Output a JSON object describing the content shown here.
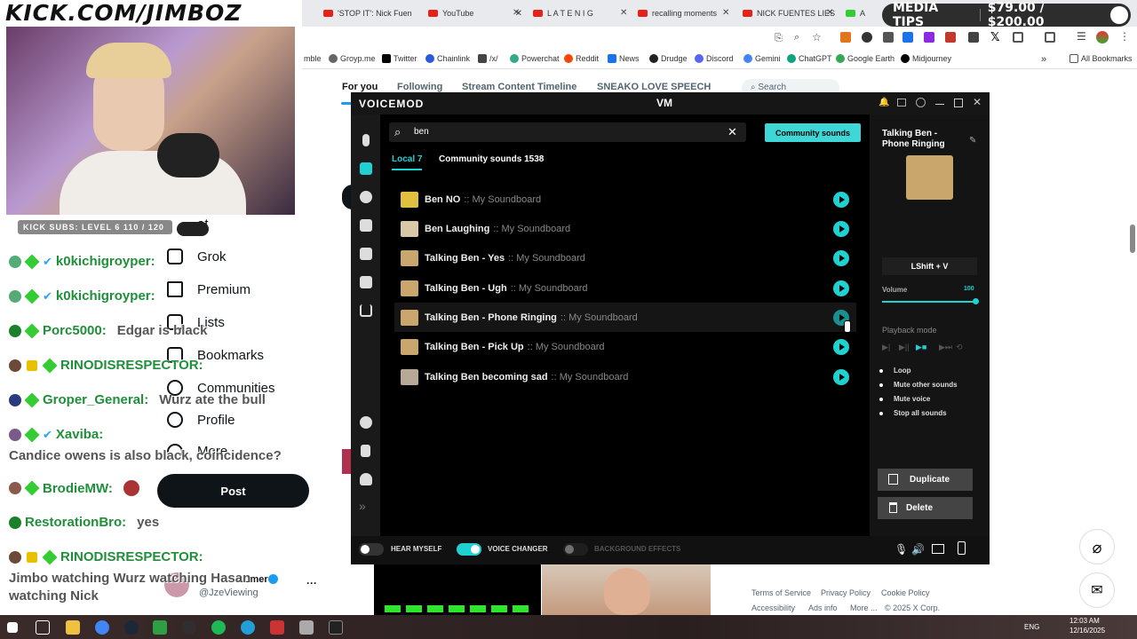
{
  "overlay": {
    "brand": "KICK.COM/JIMBOZ",
    "media_tips": "MEDIA TIPS",
    "goal": "$79.00 / $200.00",
    "kick_subs": "KICK SUBS: LEVEL 6 110 / 120"
  },
  "browser": {
    "tabs": [
      "'STOP IT': Nick Fuen",
      "YouTube",
      "L A T E   N I G",
      "recalling moments",
      "NICK FUENTES LIES",
      "A"
    ],
    "bookmarks": [
      "mble",
      "Groyp.me",
      "Twitter",
      "Chainlink",
      "/x/",
      "Powerchat",
      "Reddit",
      "News",
      "Drudge",
      "Discord",
      "Gemini",
      "ChatGPT",
      "Google Earth",
      "Midjourney"
    ],
    "all_bookmarks": "All Bookmarks"
  },
  "x": {
    "tabs": [
      "For you",
      "Following",
      "Stream Content Timeline",
      "SNEAKO LOVE SPEECH"
    ],
    "search_placeholder": "Search",
    "nav": [
      "at",
      "Grok",
      "Premium",
      "Lists",
      "Bookmarks",
      "Communities",
      "Profile",
      "More"
    ],
    "post_label": "Post",
    "account_name": "oomer",
    "account_handle": "@JzeViewing",
    "more_dots": "···",
    "footer": [
      "Terms of Service",
      "Privacy Policy",
      "Cookie Policy",
      "Accessibility",
      "Ads info",
      "More ...",
      "© 2025 X Corp."
    ]
  },
  "chat": [
    {
      "user": "k0kichigroyper:",
      "msg": ""
    },
    {
      "user": "k0kichigroyper:",
      "msg": ""
    },
    {
      "user": "Porc5000:",
      "msg": "Edgar is black"
    },
    {
      "user": "RINODISRESPECTOR:",
      "msg": ""
    },
    {
      "user": "Groper_General:",
      "msg": "Wurz ate the bull"
    },
    {
      "user": "Xaviba:",
      "msg": ""
    },
    {
      "user": "",
      "msg": "Candice owens is also black, coincidence?"
    },
    {
      "user": "BrodieMW:",
      "msg": ""
    },
    {
      "user": "RestorationBro:",
      "msg": "yes"
    },
    {
      "user": "RINODISRESPECTOR:",
      "msg": ""
    },
    {
      "user": "",
      "msg": "Jimbo watching Wurz watching Hasan"
    },
    {
      "user": "",
      "msg": "watching Nick"
    }
  ],
  "voicemod": {
    "title": "VOICEMOD",
    "search_value": "ben",
    "community_button": "Community sounds",
    "tab_local": "Local 7",
    "tab_community": "Community sounds 1538",
    "sounds": [
      {
        "name": "Ben NO",
        "board": ":: My Soundboard"
      },
      {
        "name": "Ben Laughing",
        "board": ":: My Soundboard"
      },
      {
        "name": "Talking Ben - Yes",
        "board": ":: My Soundboard"
      },
      {
        "name": "Talking Ben - Ugh",
        "board": ":: My Soundboard"
      },
      {
        "name": "Talking Ben - Phone Ringing",
        "board": ":: My Soundboard"
      },
      {
        "name": "Talking Ben - Pick Up",
        "board": ":: My Soundboard"
      },
      {
        "name": "Talking Ben becoming sad",
        "board": ":: My Soundboard"
      }
    ],
    "detail": {
      "title": "Talking Ben - Phone Ringing",
      "hotkey": "LShift + V",
      "volume_label": "Volume",
      "volume_value": "100",
      "playback_label": "Playback mode",
      "options": [
        "Loop",
        "Mute other sounds",
        "Mute voice",
        "Stop all sounds"
      ],
      "duplicate": "Duplicate",
      "delete": "Delete"
    },
    "bottom": {
      "hear_myself": "HEAR MYSELF",
      "voice_changer": "VOICE CHANGER",
      "background_effects": "BACKGROUND EFFECTS"
    }
  },
  "taskbar": {
    "lang": "ENG",
    "time": "12:03 AM",
    "date": "12/16/2025"
  }
}
